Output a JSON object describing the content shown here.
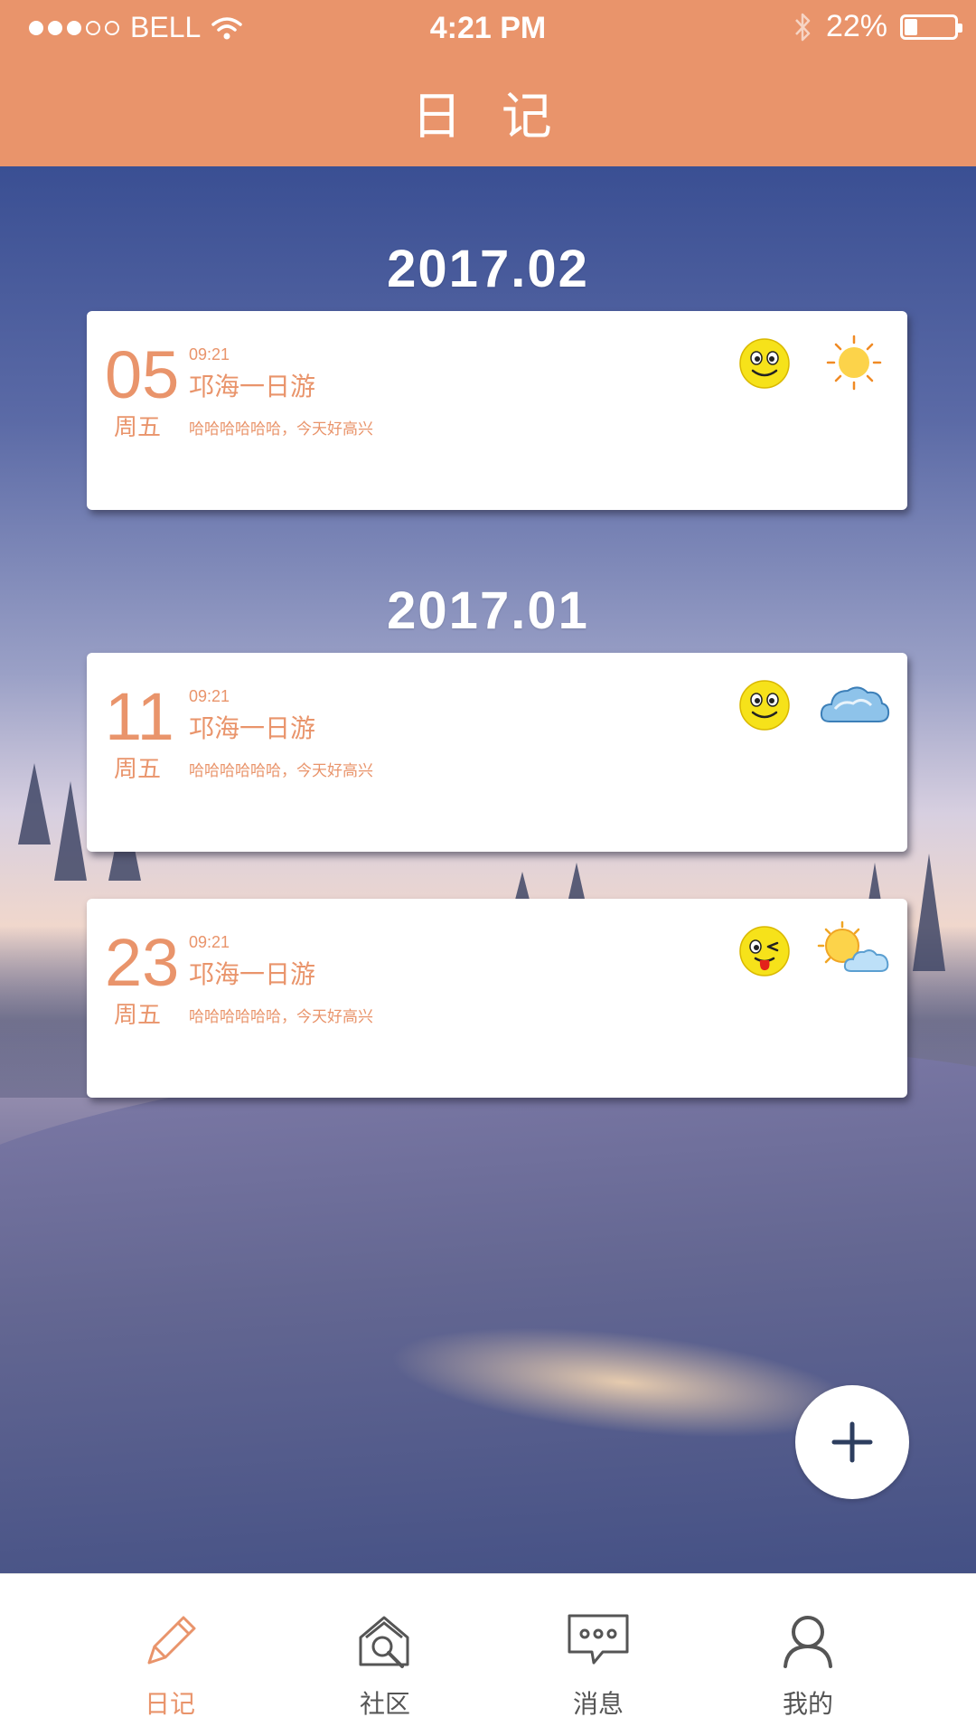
{
  "status_bar": {
    "carrier": "BELL",
    "signal_dots_filled": 3,
    "signal_dots_total": 5,
    "time": "4:21 PM",
    "battery_percent": "22%",
    "icons": [
      "wifi-icon",
      "bluetooth-icon",
      "battery-icon"
    ]
  },
  "header": {
    "title": "日 记"
  },
  "months": [
    {
      "label": "2017.02",
      "entries": [
        {
          "day": "05",
          "weekday": "周五",
          "time": "09:21",
          "title": "邛海一日游",
          "excerpt": "哈哈哈哈哈哈，今天好高兴",
          "mood": "smile-face-icon",
          "weather": "sunny-icon"
        }
      ]
    },
    {
      "label": "2017.01",
      "entries": [
        {
          "day": "11",
          "weekday": "周五",
          "time": "09:21",
          "title": "邛海一日游",
          "excerpt": "哈哈哈哈哈哈，今天好高兴",
          "mood": "smile-face-icon",
          "weather": "cloudy-icon"
        },
        {
          "day": "23",
          "weekday": "周五",
          "time": "09:21",
          "title": "邛海一日游",
          "excerpt": "哈哈哈哈哈哈，今天好高兴",
          "mood": "wink-tongue-face-icon",
          "weather": "partly-cloudy-icon"
        }
      ]
    }
  ],
  "fab": {
    "icon": "plus-icon"
  },
  "tabs": [
    {
      "label": "日记",
      "icon": "pencil-icon",
      "active": true
    },
    {
      "label": "社区",
      "icon": "community-search-icon",
      "active": false
    },
    {
      "label": "消息",
      "icon": "message-bubble-icon",
      "active": false
    },
    {
      "label": "我的",
      "icon": "user-icon",
      "active": false
    }
  ],
  "colors": {
    "accent": "#e9946b",
    "white": "#ffffff",
    "tab_inactive": "#555555"
  }
}
